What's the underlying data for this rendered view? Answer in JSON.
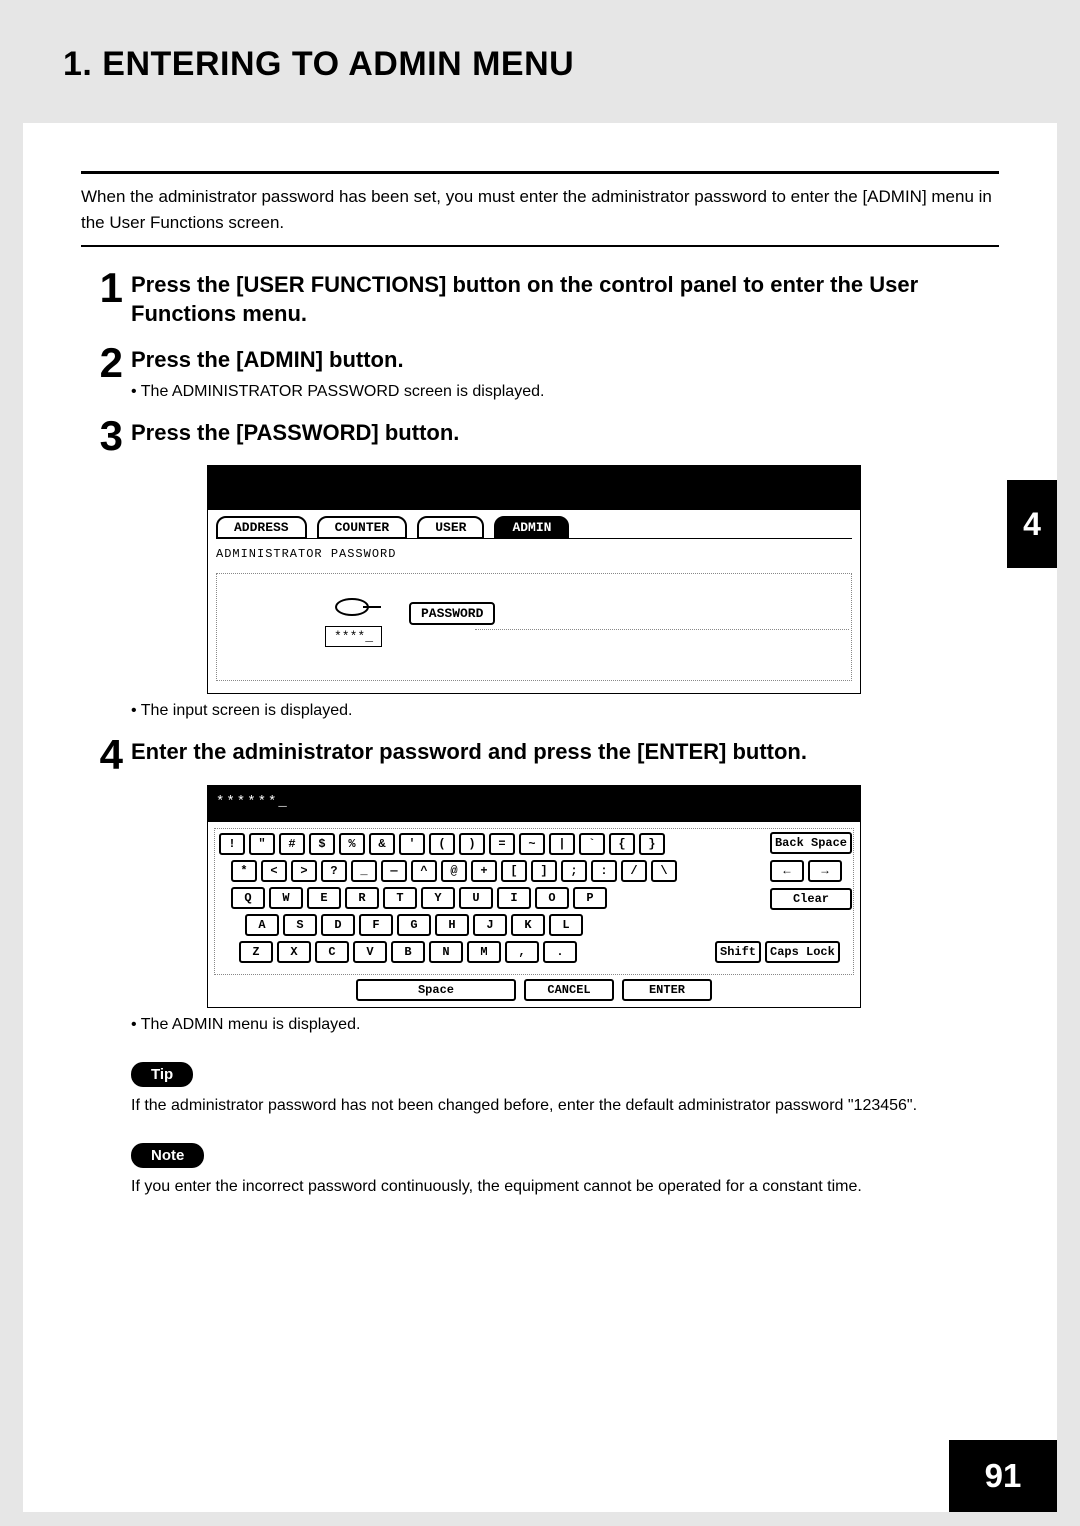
{
  "header": {
    "title": "1. ENTERING TO ADMIN MENU"
  },
  "intro": "When the administrator password has been set, you must enter the administrator password to enter the [ADMIN] menu in the User Functions screen.",
  "steps": [
    {
      "num": "1",
      "title": "Press the [USER FUNCTIONS] button on the control panel to enter the User Functions menu."
    },
    {
      "num": "2",
      "title": "Press the [ADMIN] button.",
      "bullet": "The ADMINISTRATOR PASSWORD screen is displayed."
    },
    {
      "num": "3",
      "title": "Press the [PASSWORD] button.",
      "bullet_after": "The input screen is displayed."
    },
    {
      "num": "4",
      "title": "Enter the administrator password and press the [ENTER] button.",
      "bullet_after": "The ADMIN menu is displayed."
    }
  ],
  "screen1": {
    "tabs": [
      "ADDRESS",
      "COUNTER",
      "USER",
      "ADMIN"
    ],
    "active_tab_index": 3,
    "subtitle": "ADMINISTRATOR PASSWORD",
    "mask": "****_",
    "password_button": "PASSWORD"
  },
  "screen2": {
    "input_mask": "******_",
    "rows": {
      "r1": [
        "!",
        "\"",
        "#",
        "$",
        "%",
        "&",
        "'",
        "(",
        ")",
        "=",
        "~",
        "|",
        "`",
        "{",
        "}"
      ],
      "r2": [
        "*",
        "<",
        ">",
        "?",
        "_",
        "—",
        "^",
        "@",
        "+",
        "[",
        "]",
        ";",
        ":",
        "/",
        "\\"
      ],
      "r3": [
        "Q",
        "W",
        "E",
        "R",
        "T",
        "Y",
        "U",
        "I",
        "O",
        "P"
      ],
      "r4": [
        "A",
        "S",
        "D",
        "F",
        "G",
        "H",
        "J",
        "K",
        "L"
      ],
      "r5": [
        "Z",
        "X",
        "C",
        "V",
        "B",
        "N",
        "M",
        ",",
        "."
      ]
    },
    "side": {
      "backspace": "Back Space",
      "left": "←",
      "right": "→",
      "clear": "Clear",
      "shift": "Shift",
      "caps": "Caps Lock"
    },
    "bottom": {
      "space": "Space",
      "cancel": "CANCEL",
      "enter": "ENTER"
    }
  },
  "tip": {
    "label": "Tip",
    "text": "If the administrator password has not been changed before, enter the default administrator password \"123456\"."
  },
  "note": {
    "label": "Note",
    "text": "If you enter the incorrect password continuously, the equipment cannot be operated for a constant time."
  },
  "chapter_tab": "4",
  "page_number": "91"
}
